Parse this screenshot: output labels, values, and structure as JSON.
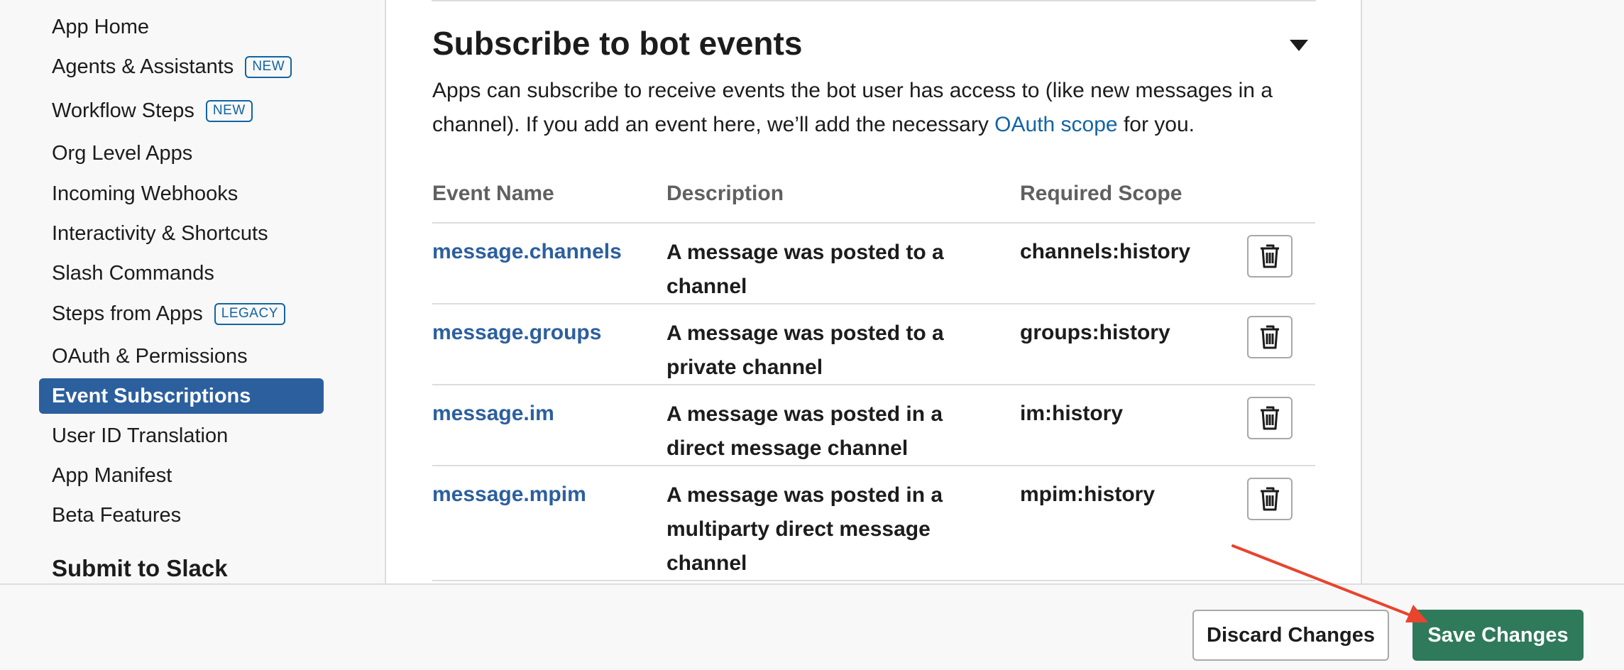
{
  "sidebar": {
    "items": [
      {
        "label": "App Home",
        "badge": ""
      },
      {
        "label": "Agents & Assistants",
        "badge": "NEW"
      },
      {
        "label": "Workflow Steps",
        "badge": "NEW"
      },
      {
        "label": "Org Level Apps",
        "badge": ""
      },
      {
        "label": "Incoming Webhooks",
        "badge": ""
      },
      {
        "label": "Interactivity & Shortcuts",
        "badge": ""
      },
      {
        "label": "Slash Commands",
        "badge": ""
      },
      {
        "label": "Steps from Apps",
        "badge": "LEGACY"
      },
      {
        "label": "OAuth & Permissions",
        "badge": ""
      },
      {
        "label": "Event Subscriptions",
        "badge": "",
        "active": true
      },
      {
        "label": "User ID Translation",
        "badge": ""
      },
      {
        "label": "App Manifest",
        "badge": ""
      },
      {
        "label": "Beta Features",
        "badge": ""
      }
    ],
    "submit_heading": "Submit to Slack"
  },
  "section": {
    "title": "Subscribe to bot events",
    "intro_before_link": "Apps can subscribe to receive events the bot user has access to (like new messages in a channel). If you add an event here, we’ll add the necessary ",
    "intro_link": "OAuth scope",
    "intro_after_link": " for you."
  },
  "table": {
    "headers": {
      "name": "Event Name",
      "description": "Description",
      "scope": "Required Scope"
    },
    "rows": [
      {
        "name": "message.channels",
        "description": "A message was posted to a channel",
        "scope": "channels:history"
      },
      {
        "name": "message.groups",
        "description": "A message was posted to a private channel",
        "scope": "groups:history"
      },
      {
        "name": "message.im",
        "description": "A message was posted in a direct message channel",
        "scope": "im:history"
      },
      {
        "name": "message.mpim",
        "description": "A message was posted in a multiparty direct message channel",
        "scope": "mpim:history"
      }
    ]
  },
  "footer": {
    "discard_label": "Discard Changes",
    "save_label": "Save Changes"
  },
  "colors": {
    "active_nav": "#2c5f9e",
    "link": "#1264a3",
    "save_button": "#2f7a5b",
    "annotation_arrow": "#e8442e"
  },
  "icons": {
    "row_action": "trash-icon",
    "section_toggle": "caret-down-icon"
  }
}
